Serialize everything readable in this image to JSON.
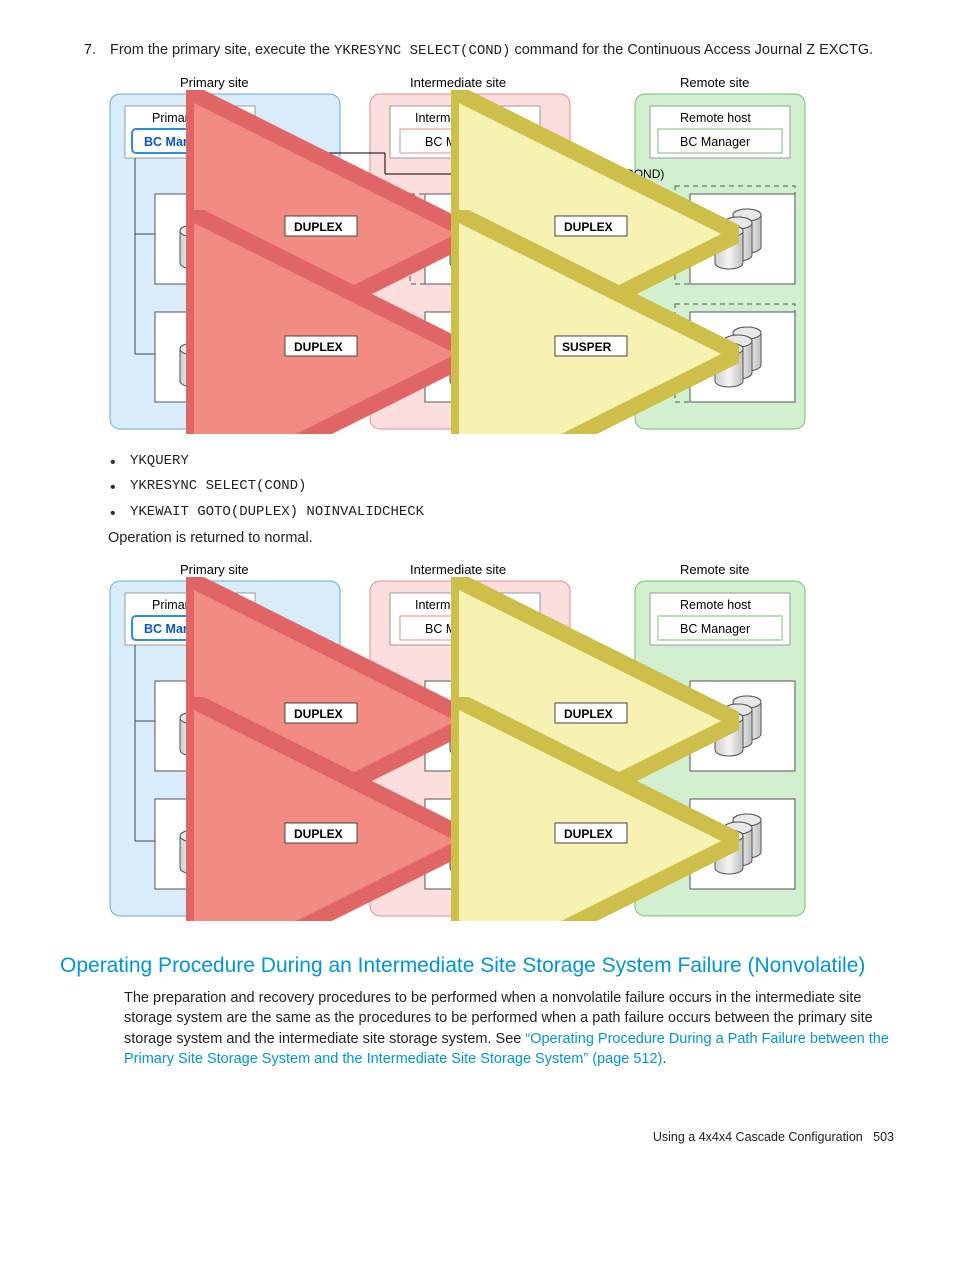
{
  "step": {
    "num": "7.",
    "text_a": "From the primary site, execute the ",
    "cmd": "YKRESYNC SELECT(COND)",
    "text_b": " command for the Continuous Access Journal Z EXCTG."
  },
  "diagram": {
    "primary_site": "Primary site",
    "intermediate_site": "Intermediate site",
    "remote_site": "Remote site",
    "primary_host": "Primary host",
    "intermediate_host": "Intermediate host",
    "remote_host": "Remote host",
    "bc_manager": "BC Manager",
    "ykresync": "YKRESYNC SELECT(COND)",
    "duplex": "DUPLEX",
    "susper": "SUSPER"
  },
  "cmds": {
    "c1": "YKQUERY",
    "c2": "YKRESYNC SELECT(COND)",
    "c3": "YKEWAIT GOTO(DUPLEX) NOINVALIDCHECK"
  },
  "para_normal": "Operation is returned to normal.",
  "section_title": "Operating Procedure During an Intermediate Site Storage System Failure (Nonvolatile)",
  "body_text_a": "The preparation and recovery procedures to be performed when a nonvolatile failure occurs in the intermediate site storage system are the same as the procedures to be performed when a path failure occurs between the primary site storage system and the intermediate site storage system. See ",
  "body_link": "“Operating Procedure During a Path Failure between the Primary Site Storage System and the Intermediate Site Storage System” (page 512)",
  "body_text_b": ".",
  "footer": "Using a 4x4x4 Cascade Configuration   503"
}
